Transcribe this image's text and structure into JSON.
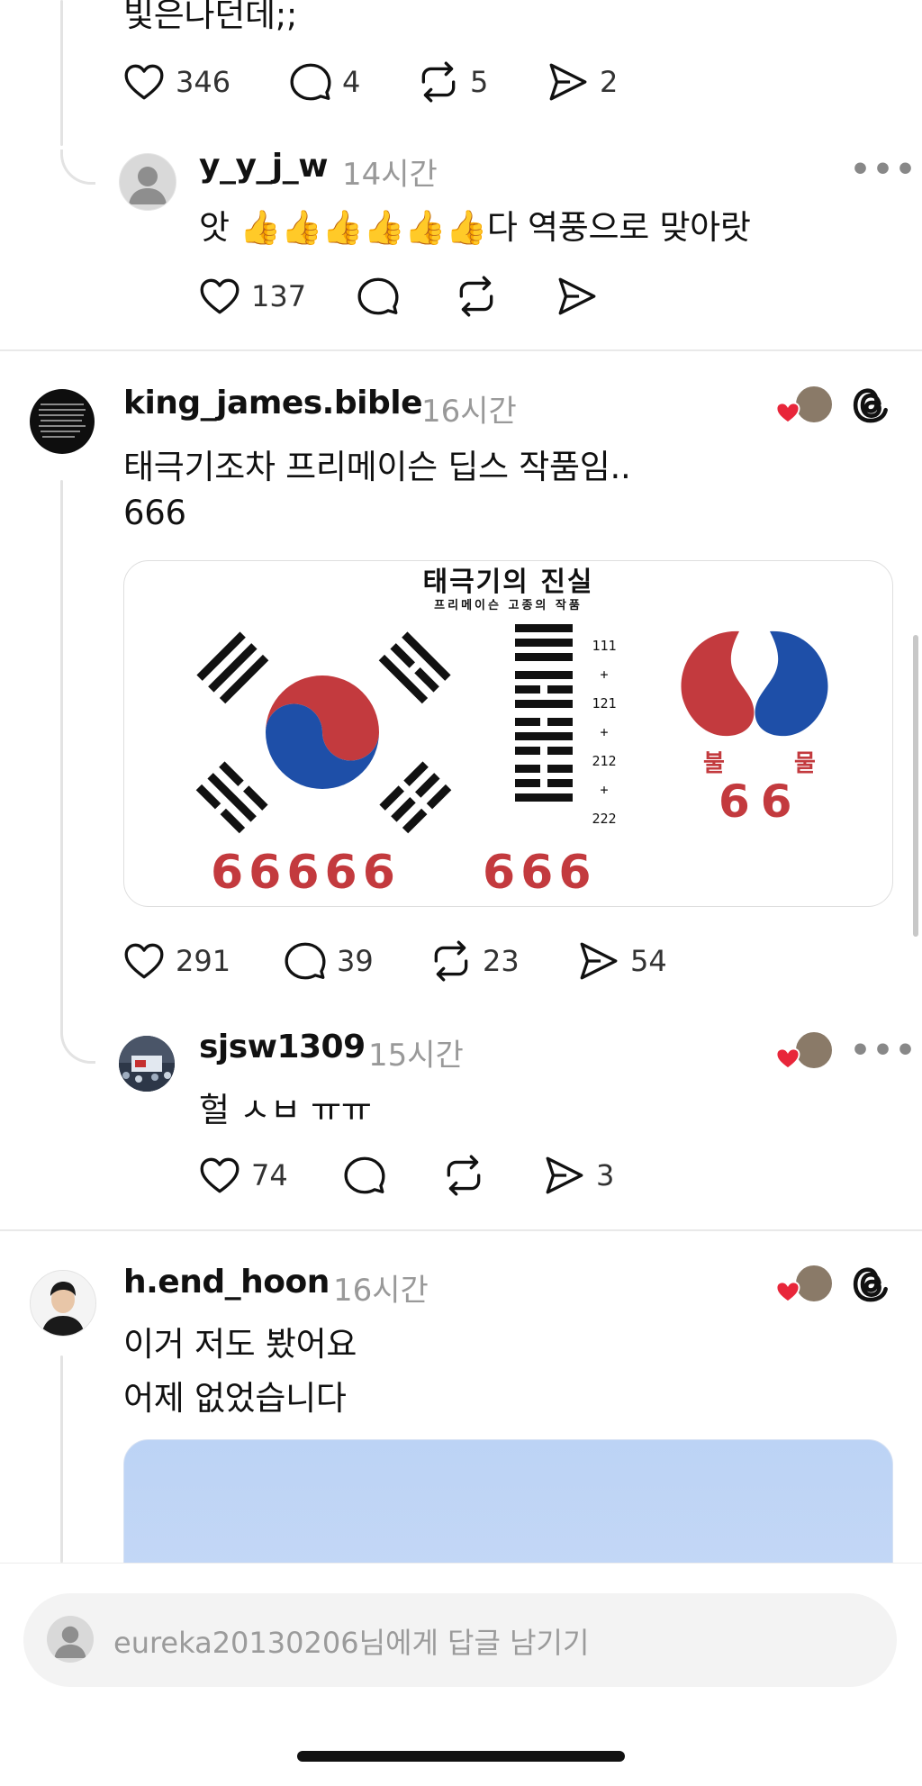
{
  "top_post": {
    "partial_text": "빛은나던데;;",
    "likes": "346",
    "comments": "4",
    "reposts": "5",
    "shares": "2"
  },
  "reply1": {
    "username": "y_y_j_w",
    "time": "14시간",
    "text": "앗 👍👍👍👍👍👍다 역풍으로 맞아랏",
    "likes": "137"
  },
  "post2": {
    "username": "king_james.bible",
    "time": "16시간",
    "line1": "태극기조차 프리메이슨 딥스 작품임..",
    "line2": "666",
    "likes": "291",
    "comments": "39",
    "reposts": "23",
    "shares": "54",
    "image": {
      "title": "태극기의 진실",
      "subtitle": "프리메이슨 고종의 작품",
      "numbers": [
        "111",
        "+",
        "121",
        "+",
        "212",
        "+",
        "222"
      ],
      "left_label": "불",
      "right_label": "물",
      "sixes_small": "66",
      "sixes_left": "66666",
      "sixes_mid": "666"
    }
  },
  "reply2": {
    "username": "sjsw1309",
    "time": "15시간",
    "text": "헐 ㅅㅂ ㅠㅠ",
    "likes": "74",
    "shares": "3"
  },
  "post3": {
    "username": "h.end_hoon",
    "time": "16시간",
    "line1": "이거 저도 봤어요",
    "line2": "어제 없었습니다"
  },
  "composer": {
    "placeholder": "eureka20130206님에게 답글 남기기"
  },
  "icons": {
    "like": "heart-icon",
    "comment": "comment-icon",
    "repost": "repost-icon",
    "share": "share-icon",
    "more": "more-icon",
    "threads": "threads-logo-icon"
  },
  "colors": {
    "red": "#c0392b",
    "blue": "#1f4aa0",
    "heart": "#e8263a",
    "photo_sky": "#c2d6f5"
  }
}
